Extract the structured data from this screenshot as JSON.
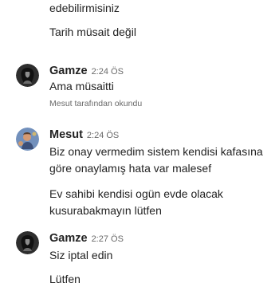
{
  "messages_top": {
    "line1": "edebilirmisiniz",
    "line2": "Tarih müsait değil"
  },
  "gamze_block_1": {
    "sender": "Gamze",
    "time": "2:24 ÖS",
    "text": "Ama müsaitti",
    "receipt": "Mesut tarafından okundu"
  },
  "mesut_block": {
    "sender": "Mesut",
    "time": "2:24 ÖS",
    "text_line1": "Biz onay vermedim sistem kendisi kafasına",
    "text_line2": "göre onaylamış hata var malesef",
    "text2_line1": "Ev sahibi kendisi ogün evde olacak",
    "text2_line2": "kusurabakmayın lütfen"
  },
  "gamze_block_2": {
    "sender": "Gamze",
    "time": "2:27 ÖS",
    "text": "Siz iptal edin",
    "partial": "Lütfen"
  },
  "icons": {
    "gamze_avatar": "person-silhouette-icon",
    "mesut_avatar": "user-photo-avatar"
  },
  "colors": {
    "text": "#222222",
    "secondary": "#6a6a6a",
    "background": "#ffffff"
  }
}
